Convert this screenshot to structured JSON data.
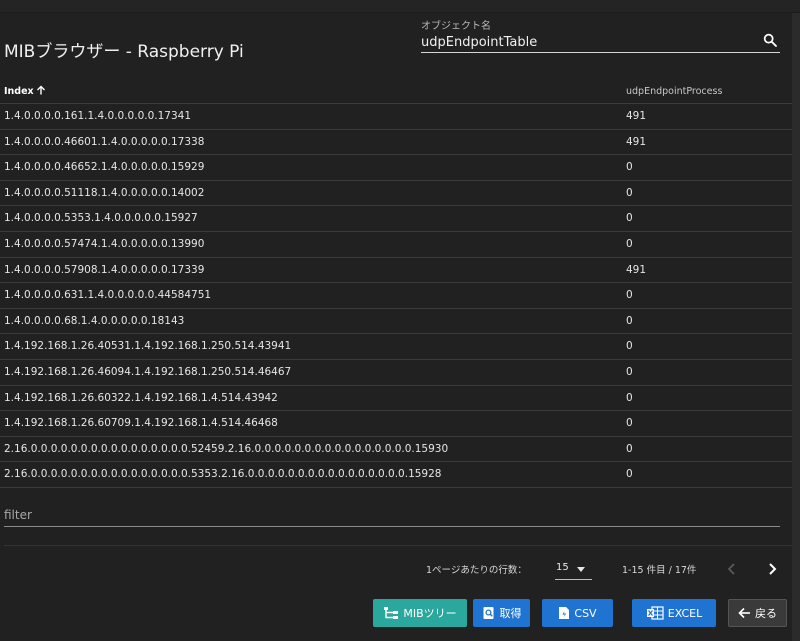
{
  "header": {
    "title": "MIBブラウザー - Raspberry Pi",
    "object_label": "オブジェクト名",
    "object_value": "udpEndpointTable"
  },
  "table": {
    "columns": [
      "Index",
      "udpEndpointProcess"
    ],
    "rows": [
      {
        "index": "1.4.0.0.0.0.161.1.4.0.0.0.0.0.17341",
        "process": "491"
      },
      {
        "index": "1.4.0.0.0.0.46601.1.4.0.0.0.0.0.17338",
        "process": "491"
      },
      {
        "index": "1.4.0.0.0.0.46652.1.4.0.0.0.0.0.15929",
        "process": "0"
      },
      {
        "index": "1.4.0.0.0.0.51118.1.4.0.0.0.0.0.14002",
        "process": "0"
      },
      {
        "index": "1.4.0.0.0.0.5353.1.4.0.0.0.0.0.15927",
        "process": "0"
      },
      {
        "index": "1.4.0.0.0.0.57474.1.4.0.0.0.0.0.13990",
        "process": "0"
      },
      {
        "index": "1.4.0.0.0.0.57908.1.4.0.0.0.0.0.17339",
        "process": "491"
      },
      {
        "index": "1.4.0.0.0.0.631.1.4.0.0.0.0.0.44584751",
        "process": "0"
      },
      {
        "index": "1.4.0.0.0.0.68.1.4.0.0.0.0.0.18143",
        "process": "0"
      },
      {
        "index": "1.4.192.168.1.26.40531.1.4.192.168.1.250.514.43941",
        "process": "0"
      },
      {
        "index": "1.4.192.168.1.26.46094.1.4.192.168.1.250.514.46467",
        "process": "0"
      },
      {
        "index": "1.4.192.168.1.26.60322.1.4.192.168.1.4.514.43942",
        "process": "0"
      },
      {
        "index": "1.4.192.168.1.26.60709.1.4.192.168.1.4.514.46468",
        "process": "0"
      },
      {
        "index": "2.16.0.0.0.0.0.0.0.0.0.0.0.0.0.0.0.0.52459.2.16.0.0.0.0.0.0.0.0.0.0.0.0.0.0.0.0.15930",
        "process": "0"
      },
      {
        "index": "2.16.0.0.0.0.0.0.0.0.0.0.0.0.0.0.0.0.5353.2.16.0.0.0.0.0.0.0.0.0.0.0.0.0.0.0.0.15928",
        "process": "0"
      }
    ]
  },
  "filter": {
    "placeholder": "filter"
  },
  "pagination": {
    "rows_per_page_label": "1ページあたりの行数：",
    "rows_per_page_value": "15",
    "range": "1-15 件目 / 17件"
  },
  "actions": {
    "mib_tree": "MIBツリー",
    "get": "取得",
    "csv": "CSV",
    "excel": "EXCEL",
    "back": "戻る"
  },
  "colors": {
    "background": "#212121",
    "mib_button": "#2ba89e",
    "primary_button": "#1f74d2"
  }
}
